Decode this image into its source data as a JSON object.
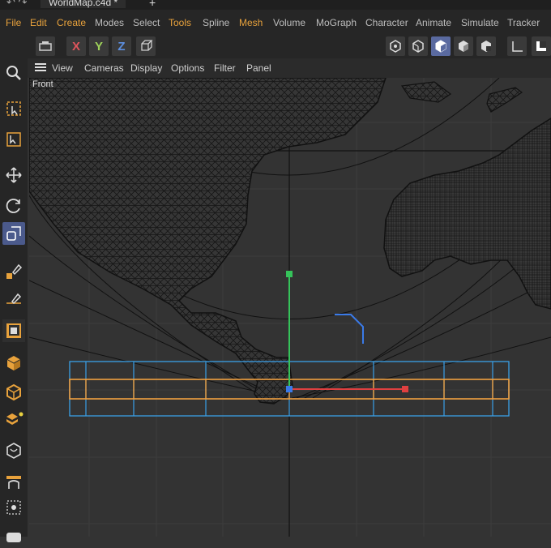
{
  "window": {
    "tab_title": "WorldMap.c4d *"
  },
  "menu": [
    {
      "label": "File",
      "color": "#e8a23c"
    },
    {
      "label": "Edit",
      "color": "#e8a23c"
    },
    {
      "label": "Create",
      "color": "#e8a23c"
    },
    {
      "label": "Modes",
      "color": "#bdbdbd"
    },
    {
      "label": "Select",
      "color": "#bdbdbd"
    },
    {
      "label": "Tools",
      "color": "#e8a23c"
    },
    {
      "label": "Spline",
      "color": "#bdbdbd"
    },
    {
      "label": "Mesh",
      "color": "#e8a23c"
    },
    {
      "label": "Volume",
      "color": "#bdbdbd"
    },
    {
      "label": "MoGraph",
      "color": "#bdbdbd"
    },
    {
      "label": "Character",
      "color": "#bdbdbd"
    },
    {
      "label": "Animate",
      "color": "#bdbdbd"
    },
    {
      "label": "Simulate",
      "color": "#bdbdbd"
    },
    {
      "label": "Tracker",
      "color": "#bdbdbd"
    }
  ],
  "axis_buttons": [
    {
      "label": "X",
      "color": "#e0555c"
    },
    {
      "label": "Y",
      "color": "#9fd35a"
    },
    {
      "label": "Z",
      "color": "#5c8fe0"
    }
  ],
  "viewport": {
    "menu": [
      "View",
      "Cameras",
      "Display",
      "Options",
      "Filter",
      "Panel"
    ],
    "label": "Front"
  },
  "colors": {
    "accent": "#e8a23c",
    "selection_active": "#4b5a8c",
    "bbox_blue": "#3aa0e8",
    "bbox_orange": "#f0a040",
    "axis_green": "#35c35a",
    "axis_red": "#e04040",
    "axis_blue": "#3a7ae8"
  }
}
